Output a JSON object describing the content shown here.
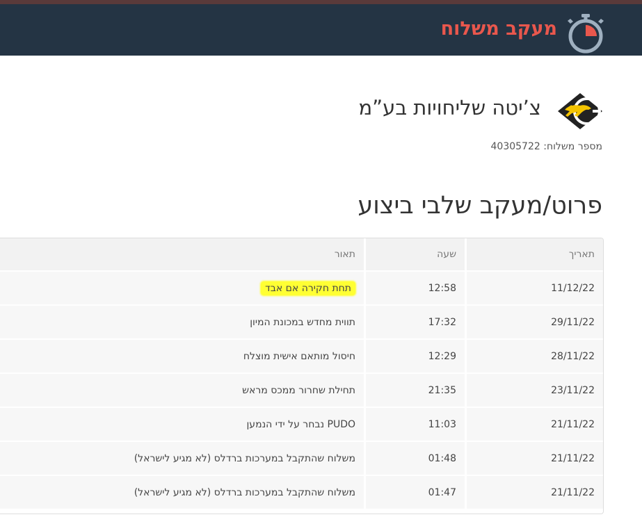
{
  "header": {
    "title": "מעקב משלוח",
    "accent_color": "#e9574d",
    "background": "#243444",
    "icon": "stopwatch-icon"
  },
  "company": {
    "name": "צ’יטה שליחויות בע”מ",
    "logo": "cheetah-logo"
  },
  "shipment": {
    "label": "מספר משלוח:",
    "number": "40305722"
  },
  "section_title": "פרוט/מעקב שלבי ביצוע",
  "table": {
    "headers": {
      "date": "תאריך",
      "time": "שעה",
      "description": "תאור"
    },
    "rows": [
      {
        "date": "11/12/22",
        "time": "12:58",
        "description": "תחת חקירה אם אבד"
      },
      {
        "date": "29/11/22",
        "time": "17:32",
        "description": "תווית מחדש במכונת המיון"
      },
      {
        "date": "28/11/22",
        "time": "12:29",
        "description": "חיסול מותאם אישית מוצלח"
      },
      {
        "date": "23/11/22",
        "time": "21:35",
        "description": "תחילת שחרור ממכס מראש"
      },
      {
        "date": "21/11/22",
        "time": "11:03",
        "description": "PUDO נבחר על ידי הנמען"
      },
      {
        "date": "21/11/22",
        "time": "01:48",
        "description": "משלוח שהתקבל במערכות ברדלס (לא מגיע לישראל)"
      },
      {
        "date": "21/11/22",
        "time": "01:47",
        "description": "משלוח שהתקבל במערכות ברדלס (לא מגיע לישראל)"
      }
    ],
    "highlight_color": "#ffff33"
  }
}
